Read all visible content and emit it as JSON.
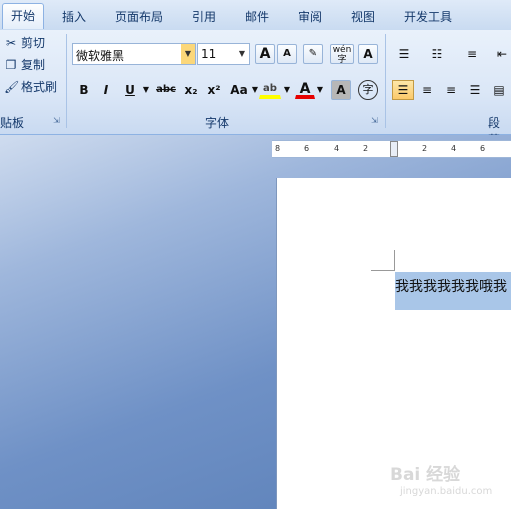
{
  "tabs": [
    "开始",
    "插入",
    "页面布局",
    "引用",
    "邮件",
    "审阅",
    "视图",
    "开发工具"
  ],
  "clipboard": {
    "cut": "剪切",
    "copy": "复制",
    "format_painter": "格式刷",
    "label": "贴板"
  },
  "font": {
    "name": "微软雅黑",
    "size": "11",
    "label": "字体",
    "grow": "A",
    "shrink": "A",
    "bold": "B",
    "italic": "I",
    "underline": "U",
    "strike": "abc",
    "subscript": "x₂",
    "superscript": "x²",
    "case": "Aa",
    "highlight": "ab",
    "color": "A",
    "shading": "A",
    "enclose": "字",
    "phonetic": "wén"
  },
  "paragraph": {
    "label": "段落"
  },
  "ruler": [
    "8",
    "6",
    "4",
    "2",
    "2",
    "4",
    "6"
  ],
  "document": {
    "selected_text": "我我我我我我哦我"
  },
  "watermark": {
    "main": "Bai 经验",
    "sub": "jingyan.baidu.com"
  }
}
